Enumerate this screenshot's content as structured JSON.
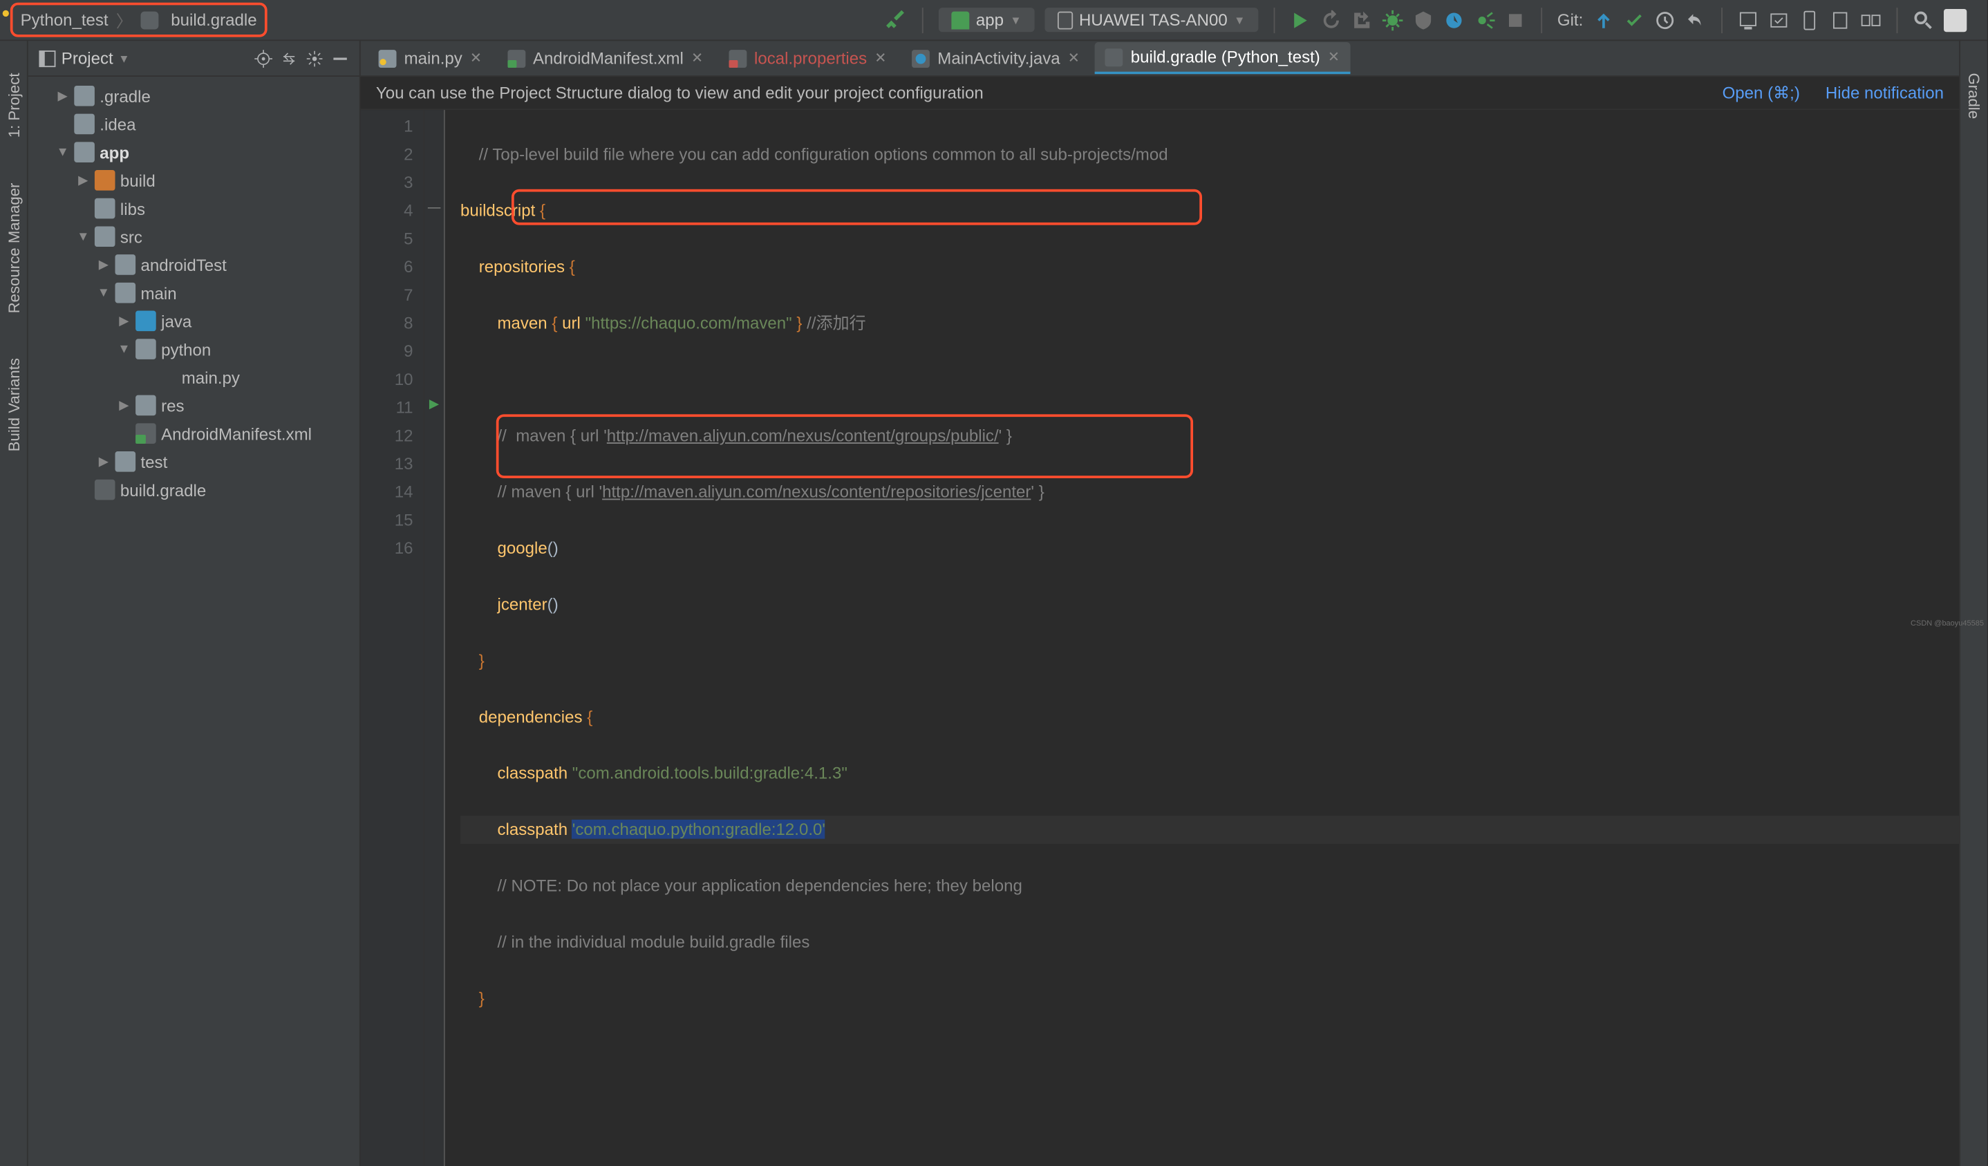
{
  "breadcrumb": {
    "project": "Python_test",
    "file": "build.gradle"
  },
  "toolbar": {
    "run_config": "app",
    "device": "HUAWEI TAS-AN00",
    "git_label": "Git:"
  },
  "left_strip": [
    "1: Project",
    "Resource Manager",
    "Build Variants"
  ],
  "right_strip": [
    "Gradle"
  ],
  "project_panel": {
    "title": "Project"
  },
  "tree": [
    {
      "d": 1,
      "chev": "right",
      "ic": "folder",
      "label": ".gradle"
    },
    {
      "d": 1,
      "chev": "none",
      "ic": "folder",
      "label": ".idea"
    },
    {
      "d": 1,
      "chev": "down",
      "ic": "folder",
      "label": "app",
      "bold": true
    },
    {
      "d": 2,
      "chev": "right",
      "ic": "folder-o",
      "label": "build"
    },
    {
      "d": 2,
      "chev": "none",
      "ic": "folder",
      "label": "libs"
    },
    {
      "d": 2,
      "chev": "down",
      "ic": "folder",
      "label": "src"
    },
    {
      "d": 3,
      "chev": "right",
      "ic": "folder",
      "label": "androidTest"
    },
    {
      "d": 3,
      "chev": "down",
      "ic": "folder",
      "label": "main"
    },
    {
      "d": 4,
      "chev": "right",
      "ic": "folder-b",
      "label": "java"
    },
    {
      "d": 4,
      "chev": "down",
      "ic": "folder",
      "label": "python"
    },
    {
      "d": 5,
      "chev": "none",
      "ic": "py",
      "label": "main.py"
    },
    {
      "d": 4,
      "chev": "right",
      "ic": "folder",
      "label": "res"
    },
    {
      "d": 4,
      "chev": "none",
      "ic": "xml",
      "label": "AndroidManifest.xml"
    },
    {
      "d": 3,
      "chev": "right",
      "ic": "folder",
      "label": "test"
    },
    {
      "d": 2,
      "chev": "none",
      "ic": "gradle-f",
      "label": "build.gradle"
    }
  ],
  "tabs": [
    {
      "icon": "py",
      "label": "main.py",
      "active": false
    },
    {
      "icon": "xml",
      "label": "AndroidManifest.xml",
      "active": false
    },
    {
      "icon": "prop",
      "label": "local.properties",
      "active": false,
      "red": true
    },
    {
      "icon": "java",
      "label": "MainActivity.java",
      "active": false
    },
    {
      "icon": "gradle",
      "label": "build.gradle (Python_test)",
      "active": true
    }
  ],
  "notif": {
    "msg": "You can use the Project Structure dialog to view and edit your project configuration",
    "open": "Open (⌘;)",
    "hide": "Hide notification"
  },
  "code": {
    "line1_cm": "// Top-level build file where you can add configuration options common to all sub-projects/mod",
    "line4_url": "\"https://chaquo.com/maven\"",
    "line4_cm": "//添加行",
    "line6a": "//  maven { url '",
    "line6b": "http://maven.aliyun.com/nexus/content/groups/public/",
    "line6c": "' }",
    "line7a": "// maven { url '",
    "line7b": "http://maven.aliyun.com/nexus/content/repositories/jcenter",
    "line7c": "' }",
    "line12_str": "\"com.android.tools.build:gradle:4.1.3\"",
    "line13_str": "'com.chaquo.python:gradle:12.0.0'",
    "line14_cm": "// NOTE: Do not place your application dependencies here; they belong",
    "line15_cm": "// in the individual module build.gradle files",
    "kw": {
      "bs": "buildscript",
      "rp": "repositories",
      "mv": "maven",
      "url": "url",
      "gg": "google",
      "jc": "jcenter",
      "dp": "dependencies",
      "cp": "classpath"
    }
  },
  "watermark": "CSDN @baoyu45585"
}
